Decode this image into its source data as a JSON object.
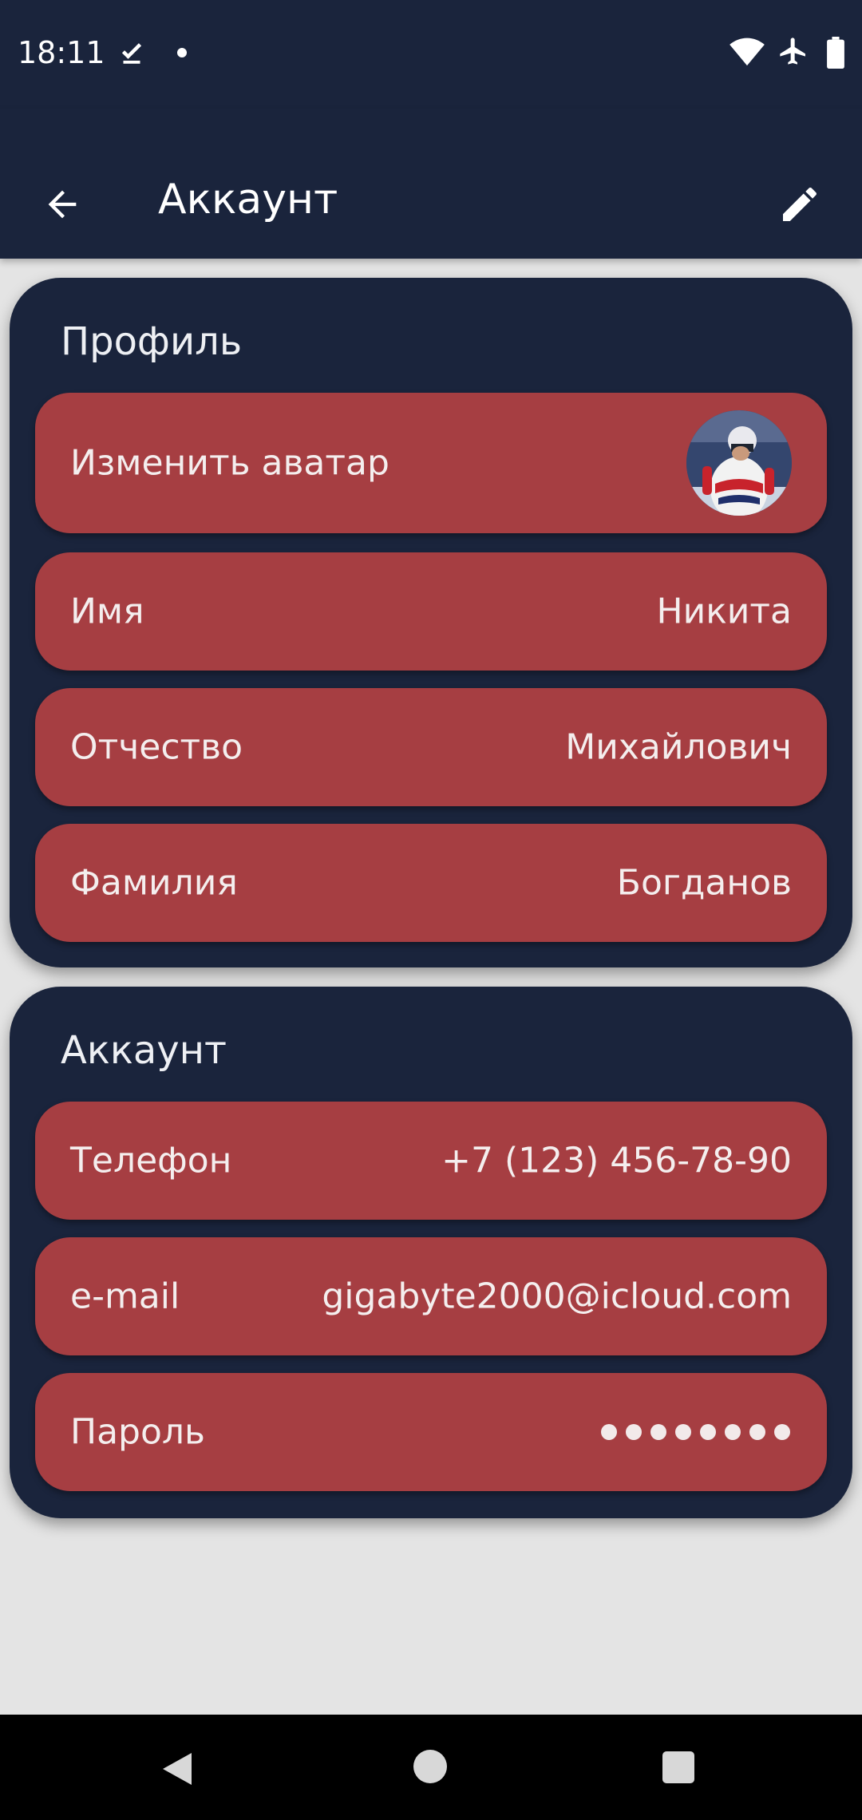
{
  "status_bar": {
    "time": "18:11",
    "icons": [
      "check-download-icon",
      "notification-dot-icon",
      "wifi-icon",
      "airplane-mode-icon",
      "battery-icon"
    ]
  },
  "app_bar": {
    "title": "Аккаунт",
    "back_icon": "arrow-back-icon",
    "edit_icon": "pencil-edit-icon"
  },
  "profile": {
    "title": "Профиль",
    "avatar_row": {
      "label": "Изменить аватар"
    },
    "rows": [
      {
        "label": "Имя",
        "value": "Никита"
      },
      {
        "label": "Отчество",
        "value": "Михайлович"
      },
      {
        "label": "Фамилия",
        "value": "Богданов"
      }
    ]
  },
  "account": {
    "title": "Аккаунт",
    "phone": {
      "label": "Телефон",
      "value": "+7 (123) 456-78-90"
    },
    "email": {
      "label": "e-mail",
      "value": "gigabyte2000@icloud.com"
    },
    "password": {
      "label": "Пароль",
      "masked_char_count": 8
    }
  },
  "colors": {
    "background": "#e4e4e4",
    "primary_dark": "#1a243c",
    "row_accent": "#a63e42",
    "text": "#ffffff"
  },
  "nav_bar": {
    "icons": [
      "nav-back-icon",
      "nav-home-icon",
      "nav-recents-icon"
    ]
  }
}
